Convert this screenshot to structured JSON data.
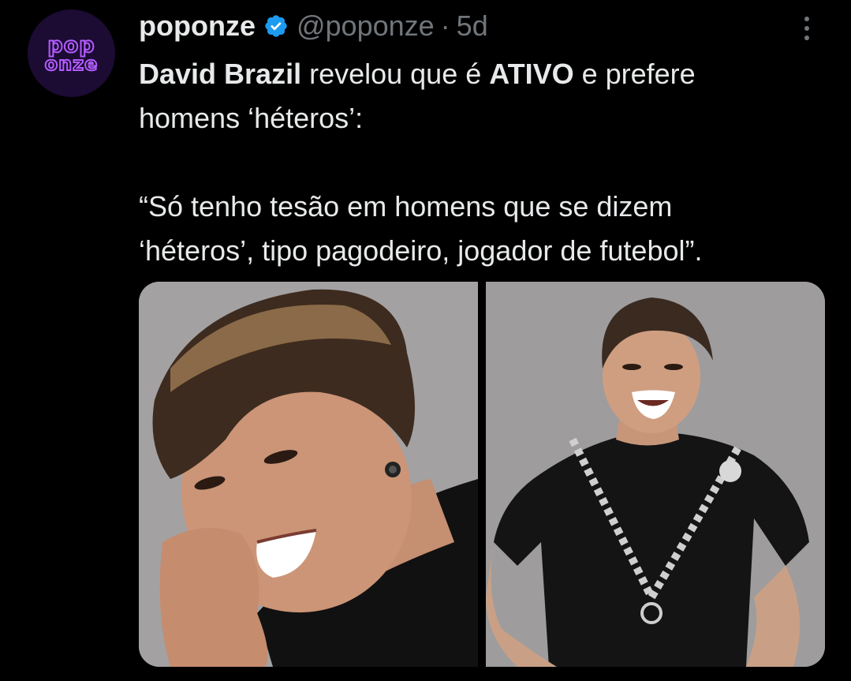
{
  "author": {
    "display_name": "poponze",
    "handle": "@poponze",
    "separator": "·",
    "time": "5d",
    "avatar_text_top": "pop",
    "avatar_text_bottom": "onze",
    "verified_icon": "verified-badge-icon",
    "verified_color": "#1d9bf0"
  },
  "tweet": {
    "line1_bold1": "David Brazil",
    "line1_text1": " revelou que é ",
    "line1_bold2": "ATIVO",
    "line1_text2": " e prefere",
    "line2": "homens ‘héteros’:",
    "line3": "“Só tenho tesão em homens que se dizem",
    "line4": "‘héteros’, tipo pagodeiro, jogador de futebol”."
  },
  "media": {
    "count": 2,
    "images": [
      {
        "name": "photo-left",
        "description_icon": "portrait-photo"
      },
      {
        "name": "photo-right",
        "description_icon": "portrait-photo"
      }
    ]
  },
  "menu": {
    "icon": "more-vertical-icon"
  },
  "colors": {
    "background": "#000000",
    "text": "#e7e9ea",
    "muted": "#71767b",
    "avatar_bg": "#1c0b33",
    "avatar_accent": "#b35cff"
  }
}
